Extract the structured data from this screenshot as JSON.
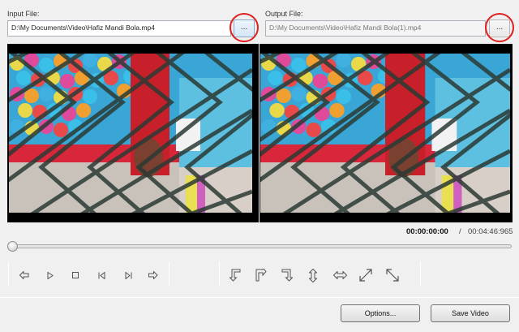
{
  "input": {
    "label": "Input File:",
    "value": "D:\\My Documents\\Video\\Hafiz Mandi Bola.mp4",
    "browse_label": "..."
  },
  "output": {
    "label": "Output File:",
    "value": "D:\\My Documents\\Video\\Hafiz Mandi Bola(1).mp4",
    "browse_label": "..."
  },
  "playback": {
    "current_time": "00:00:00:00",
    "separator": "/",
    "total_time": "00:04:46:965",
    "progress": 0
  },
  "controls": {
    "playback": [
      "rewind-icon",
      "play-icon",
      "stop-icon",
      "previous-frame-icon",
      "next-frame-icon",
      "forward-icon"
    ],
    "transform": [
      "rotate-left-icon",
      "rotate-right-icon",
      "rotate-down-icon",
      "flip-vertical-icon",
      "flip-horizontal-icon",
      "diagonal-flip-icon",
      "diagonal-flip-alt-icon"
    ]
  },
  "buttons": {
    "options": "Options...",
    "save": "Save Video"
  },
  "colors": {
    "highlight_circle": "#e02020",
    "video_background": "#000000"
  }
}
